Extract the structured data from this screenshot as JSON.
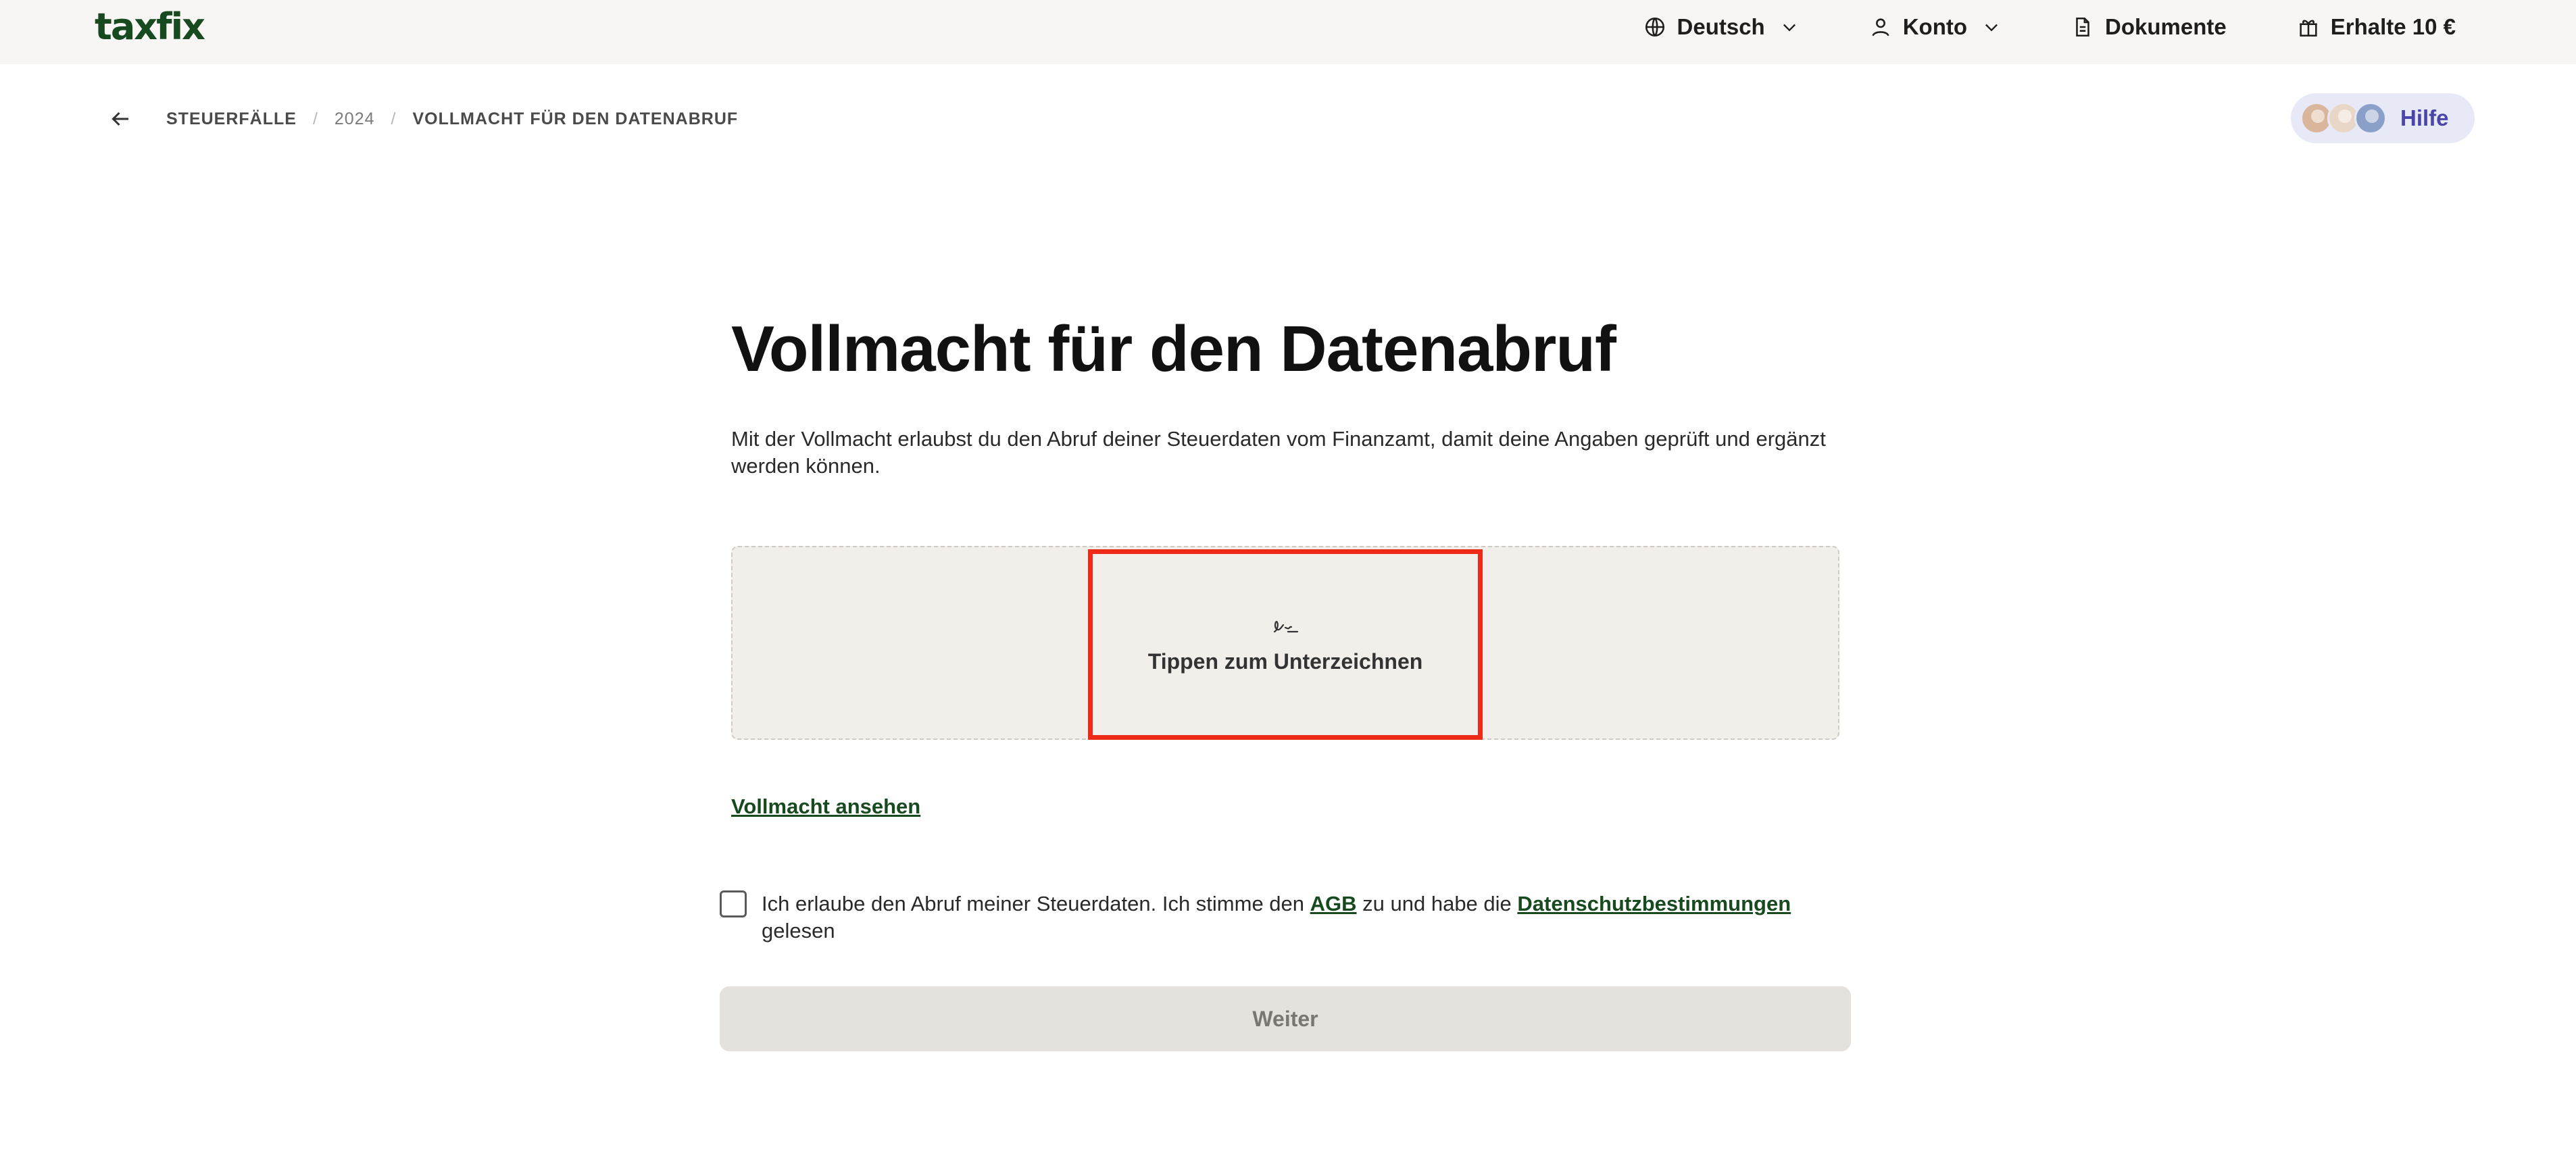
{
  "brand": {
    "logo_text": "taxfix",
    "color": "#174a1f"
  },
  "nav": {
    "language": "Deutsch",
    "account": "Konto",
    "documents": "Dokumente",
    "referral": "Erhalte 10 €"
  },
  "breadcrumb": {
    "items": [
      "STEUERFÄLLE",
      "2024",
      "VOLLMACHT FÜR DEN DATENABRUF"
    ],
    "separator": "/"
  },
  "help": {
    "label": "Hilfe"
  },
  "main": {
    "title": "Vollmacht für den Datenabruf",
    "description": "Mit der Vollmacht erlaubst du den Abruf deiner Steuerdaten vom Finanzamt, damit deine Angaben geprüft und ergänzt werden können.",
    "sign_label": "Tippen zum Unterzeichnen",
    "view_link": "Vollmacht ansehen",
    "consent": {
      "part1": "Ich erlaube den Abruf meiner Steuerdaten. Ich stimme den ",
      "agb": "AGB",
      "part2": " zu und habe die ",
      "privacy": "Datenschutzbestimmungen",
      "part3": " gelesen"
    },
    "continue_label": "Weiter"
  },
  "colors": {
    "highlight": "#ee2a18",
    "accent_green": "#174a1f",
    "help_bg": "#e7e9f7",
    "help_text": "#4a45a8"
  }
}
